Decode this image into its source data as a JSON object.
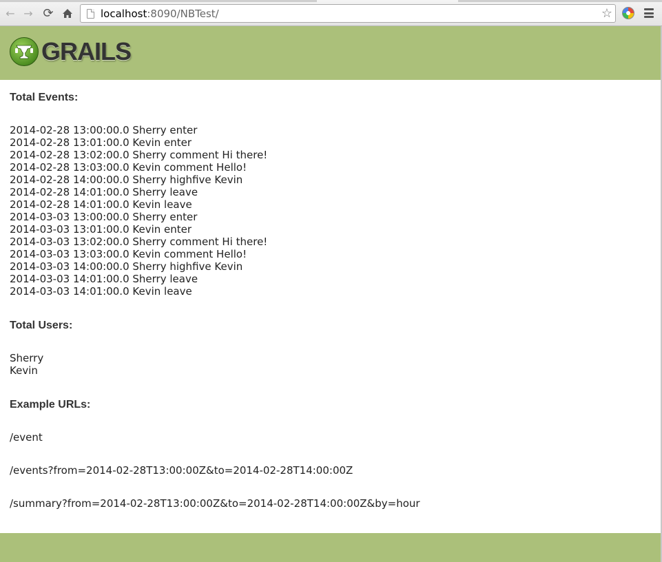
{
  "browser": {
    "url_host": "localhost",
    "url_rest": ":8090/NBTest/"
  },
  "logo": {
    "text": "GRAILS"
  },
  "sections": {
    "events_title": "Total Events:",
    "users_title": "Total Users:",
    "urls_title": "Example URLs:"
  },
  "events": [
    "2014-02-28 13:00:00.0 Sherry enter",
    "2014-02-28 13:01:00.0 Kevin enter",
    "2014-02-28 13:02:00.0 Sherry comment Hi there!",
    "2014-02-28 13:03:00.0 Kevin comment Hello!",
    "2014-02-28 14:00:00.0 Sherry highfive Kevin",
    "2014-02-28 14:01:00.0 Sherry leave",
    "2014-02-28 14:01:00.0 Kevin leave",
    "2014-03-03 13:00:00.0 Sherry enter",
    "2014-03-03 13:01:00.0 Kevin enter",
    "2014-03-03 13:02:00.0 Sherry comment Hi there!",
    "2014-03-03 13:03:00.0 Kevin comment Hello!",
    "2014-03-03 14:00:00.0 Sherry highfive Kevin",
    "2014-03-03 14:01:00.0 Sherry leave",
    "2014-03-03 14:01:00.0 Kevin leave"
  ],
  "users": [
    "Sherry",
    "Kevin"
  ],
  "example_urls": [
    "/event",
    "/events?from=2014-02-28T13:00:00Z&to=2014-02-28T14:00:00Z",
    "/summary?from=2014-02-28T13:00:00Z&to=2014-02-28T14:00:00Z&by=hour"
  ],
  "colors": {
    "header_green": "#abc07a",
    "text": "#333333"
  }
}
